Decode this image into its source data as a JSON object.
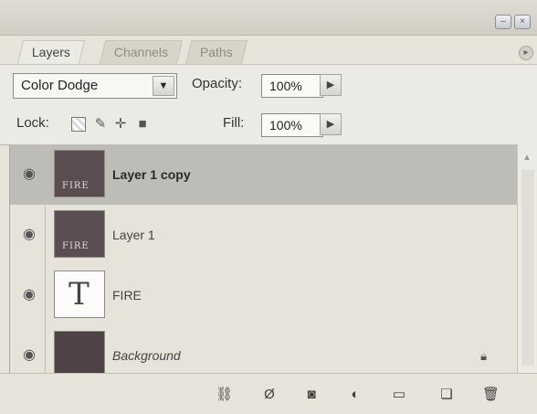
{
  "window": {
    "minimize_icon": "minimize-icon",
    "close_icon": "close-icon"
  },
  "tabs": [
    {
      "label": "Layers",
      "active": true
    },
    {
      "label": "Channels",
      "active": false
    },
    {
      "label": "Paths",
      "active": false
    }
  ],
  "panel_menu_icon": "panel-menu-icon",
  "blend_mode": {
    "value": "Color Dodge",
    "dropdown_icon": "dropdown-arrow-icon"
  },
  "opacity": {
    "label": "Opacity:",
    "value": "100%"
  },
  "lock": {
    "label": "Lock:",
    "icons": [
      "lock-transparent-pixels-icon",
      "lock-image-pixels-icon",
      "lock-position-icon",
      "lock-all-icon"
    ]
  },
  "fill": {
    "label": "Fill:",
    "value": "100%"
  },
  "layers": [
    {
      "name": "Layer 1 copy",
      "selected": true,
      "thumb_text": "FIRE",
      "type": "image"
    },
    {
      "name": "Layer 1",
      "selected": false,
      "thumb_text": "FIRE",
      "type": "image"
    },
    {
      "name": "FIRE",
      "selected": false,
      "thumb_text": "T",
      "type": "text"
    },
    {
      "name": "Background",
      "selected": false,
      "type": "background",
      "locked": true
    }
  ],
  "bottom_toolbar": {
    "icons": [
      "link-layers-icon",
      "layer-style-icon",
      "layer-mask-icon",
      "adjustment-layer-icon",
      "new-group-icon",
      "new-layer-icon",
      "delete-layer-icon"
    ]
  }
}
